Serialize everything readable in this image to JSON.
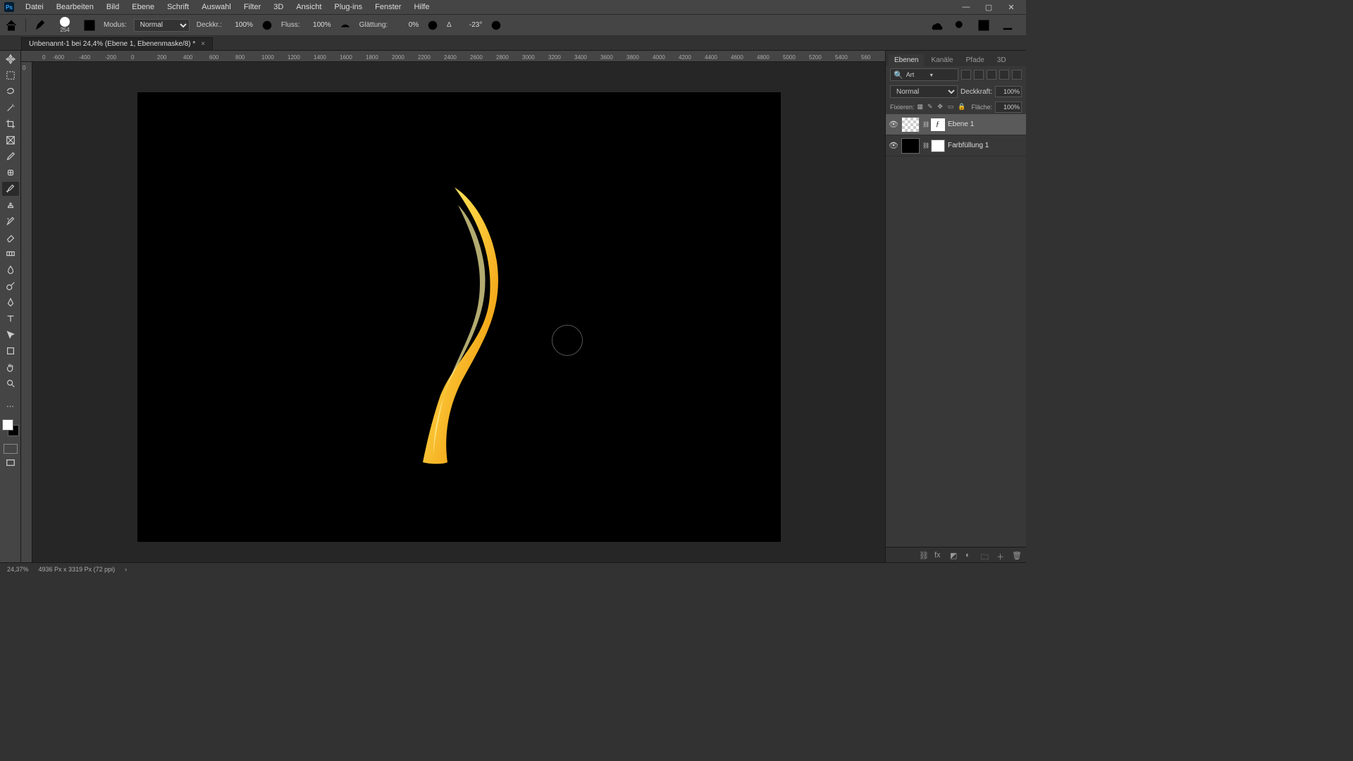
{
  "menu": {
    "items": [
      "Datei",
      "Bearbeiten",
      "Bild",
      "Ebene",
      "Schrift",
      "Auswahl",
      "Filter",
      "3D",
      "Ansicht",
      "Plug-ins",
      "Fenster",
      "Hilfe"
    ],
    "logo": "Ps"
  },
  "options": {
    "brush_size": "254",
    "mode_label": "Modus:",
    "mode_value": "Normal",
    "opacity_label": "Deckkr.:",
    "opacity_value": "100%",
    "flow_label": "Fluss:",
    "flow_value": "100%",
    "smoothing_label": "Glättung:",
    "smoothing_value": "0%",
    "angle_icon": "∆",
    "angle_value": "-23°"
  },
  "doc": {
    "tab_title": "Unbenannt-1 bei 24,4% (Ebene 1, Ebenenmaske/8) *"
  },
  "ruler_h": [
    "0",
    "-600",
    "-400",
    "-200",
    "0",
    "200",
    "400",
    "600",
    "800",
    "1000",
    "1200",
    "1400",
    "1600",
    "1800",
    "2000",
    "2200",
    "2400",
    "2600",
    "2800",
    "3000",
    "3200",
    "3400",
    "3600",
    "3800",
    "4000",
    "4200",
    "4400",
    "4600",
    "4800",
    "5000",
    "5200",
    "5400",
    "560"
  ],
  "panels": {
    "tabs": [
      "Ebenen",
      "Kanäle",
      "Pfade",
      "3D"
    ],
    "search_placeholder": "Art",
    "blend_label": "Normal",
    "opacity_label": "Deckkraft:",
    "opacity_value": "100%",
    "lock_label": "Fixieren:",
    "fill_label": "Fläche:",
    "fill_value": "100%",
    "layers": [
      {
        "name": "Ebene 1"
      },
      {
        "name": "Farbfüllung 1"
      }
    ]
  },
  "status": {
    "zoom": "24,37%",
    "doc_info": "4936 Px x 3319 Px (72 ppi)"
  }
}
